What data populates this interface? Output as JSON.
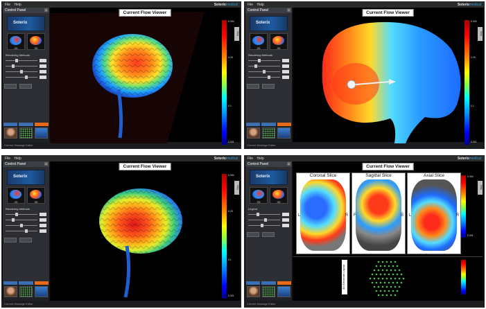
{
  "panels": [
    {
      "menu": [
        "File",
        "Help"
      ],
      "brand": {
        "name": "Soterix",
        "suffix": "medical"
      },
      "control_panel": {
        "title": "Control Panel",
        "logo": "Soterix",
        "thumb_labels": [
          "2D",
          "3D"
        ],
        "section_label": "Rendering Methods",
        "status": "Current Montage Editor"
      },
      "viewer_title": "Current Flow Viewer",
      "help_label": "Help",
      "cbar_labels": [
        "0.394",
        "0.25",
        "0.1",
        "0.001"
      ]
    },
    {
      "menu": [
        "File",
        "Help"
      ],
      "brand": {
        "name": "Soterix",
        "suffix": "medical"
      },
      "control_panel": {
        "title": "Control Panel",
        "logo": "Soterix",
        "thumb_labels": [
          "2D",
          "3D"
        ],
        "section_label": "Rendering Methods",
        "status": "Current Montage Editor"
      },
      "viewer_title": "Current Flow Viewer",
      "help_label": "Help",
      "cbar_labels": [
        "0.394",
        "0.25",
        "0.1",
        "0.001"
      ]
    },
    {
      "menu": [
        "File",
        "Help"
      ],
      "brand": {
        "name": "Soterix",
        "suffix": "medical"
      },
      "control_panel": {
        "title": "Control Panel",
        "logo": "Soterix",
        "thumb_labels": [
          "2D",
          "3D"
        ],
        "section_label": "Rendering Methods",
        "status": "Current Montage Editor"
      },
      "viewer_title": "Current Flow Viewer",
      "help_label": "Help",
      "cbar_labels": [
        "0.394",
        "0.25",
        "0.1",
        "0.001"
      ]
    },
    {
      "menu": [
        "File",
        "Help"
      ],
      "brand": {
        "name": "Soterix",
        "suffix": "medical"
      },
      "control_panel": {
        "title": "Control Panel",
        "logo": "Soterix",
        "thumb_labels": [
          "2D",
          "3D"
        ],
        "section_label": "Legend",
        "status": "Current Montage Editor"
      },
      "viewer_title": "Current Flow Viewer",
      "help_label": "Help",
      "cbar_labels": [
        "0.394",
        "0.25",
        "0.1",
        "0.001"
      ],
      "slices": [
        {
          "title": "Coronal Slice",
          "left": "L",
          "right": "R"
        },
        {
          "title": "Sagittal Slice",
          "left": "F",
          "right": "B"
        },
        {
          "title": "Axial Slice",
          "left": "L",
          "right": "R"
        }
      ],
      "electrode_label": "3D Electrode Layout"
    }
  ],
  "colors": {
    "accent": "#3a6fb4",
    "orange_tab": "#e66a1a",
    "brand_blue": "#3aa0e0"
  }
}
